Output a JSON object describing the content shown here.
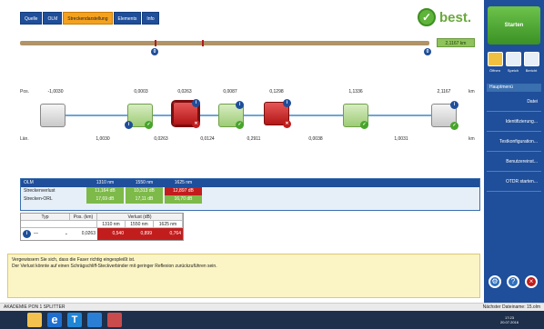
{
  "tabs": [
    {
      "label": "Quelle"
    },
    {
      "label": "OLM"
    },
    {
      "label": "Streckendarstellung"
    },
    {
      "label": "Elements"
    },
    {
      "label": "Info"
    }
  ],
  "brand": {
    "name": "best."
  },
  "link_bar": {
    "length_badge": "2,1167 km",
    "pin_a": "0",
    "pin_b": "0"
  },
  "link_view": {
    "pos_label": "Pos.",
    "len_label": "Län.",
    "unit_top": "km",
    "unit_bottom": "km",
    "positions_top": [
      "-1,0030",
      "0,0003",
      "0,0263",
      "0,0087",
      "0,1298",
      "1,1336",
      "2,1167"
    ],
    "positions_bottom": [
      "1,0030",
      "0,0263",
      "0,0124",
      "0,2911",
      "0,0038",
      "1,0031"
    ]
  },
  "summary": {
    "headers": [
      "OLM",
      "1310 nm",
      "1550 nm",
      "1625 nm"
    ],
    "rows": [
      {
        "label": "Streckenverlust",
        "values": [
          "11,164 dB",
          "10,313 dB",
          "12,897 dB"
        ],
        "status": [
          "ok",
          "ok",
          "fail"
        ]
      },
      {
        "label": "Strecken-ORL",
        "values": [
          "17,69 dB",
          "17,11 dB",
          "16,70 dB"
        ],
        "status": [
          "ok",
          "ok",
          "ok"
        ]
      }
    ]
  },
  "event_table": {
    "headers": {
      "type": "Typ",
      "pos": "Pos. (km)",
      "loss": "Verlust (dB)"
    },
    "wavelengths": [
      "1310 nm",
      "1550 nm",
      "1625 nm"
    ],
    "row": {
      "type": "—",
      "pos": "0,0263",
      "values": [
        "0,540",
        "0,899",
        "0,764"
      ]
    }
  },
  "info": {
    "line1": "Vergewissern Sie sich, dass die Faser richtig eingespleißt ist.",
    "line2": "Der Verlust könnte auf einen Schrägschliff-Steckverbinder mit geringer Reflexion zurückzuführen sein."
  },
  "right_panel": {
    "start_label": "Starten",
    "tools": [
      "Öffnen",
      "Speich",
      "Bericht"
    ],
    "menu_header": "Hauptmenü",
    "menu_items": [
      "Datei",
      "Identifizierung...",
      "Testkonfiguration...",
      "Benutzereinst...",
      "OTDR starten..."
    ]
  },
  "status": {
    "left": "AKADEMIE PON 1 SPLITTER",
    "right": "Nächster Dateiname: 15.olm"
  },
  "taskbar": {
    "time": "17:23",
    "date": "20.07.2016"
  }
}
